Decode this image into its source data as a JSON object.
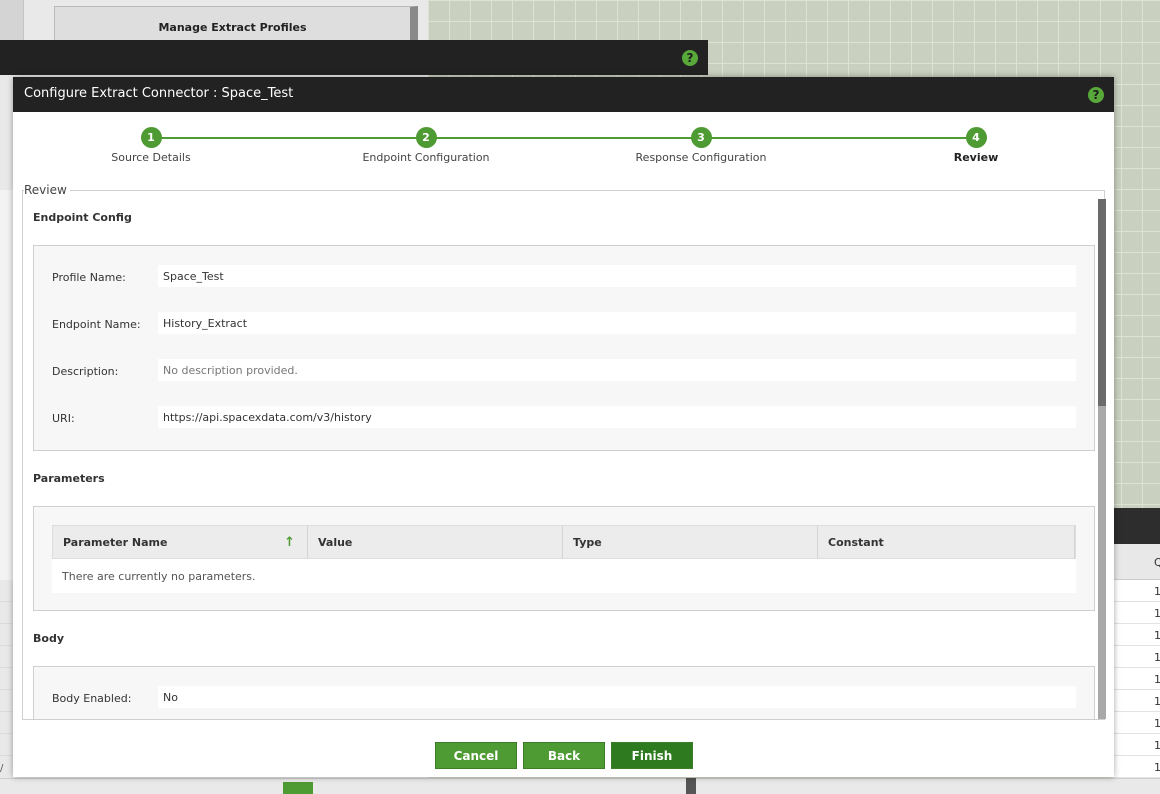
{
  "background": {
    "manage_profiles_title": "Manage Extract Profiles",
    "right_table_header": "Q",
    "right_table_rows": [
      "1",
      "1",
      "1",
      "1",
      "1",
      "1",
      "1",
      "1",
      "1"
    ],
    "left_fragment": "/"
  },
  "dialog": {
    "title": "Configure Extract Connector : Space_Test",
    "help_icon": "?"
  },
  "wizard": {
    "steps": [
      {
        "number": "1",
        "label": "Source Details"
      },
      {
        "number": "2",
        "label": "Endpoint Configuration"
      },
      {
        "number": "3",
        "label": "Response Configuration"
      },
      {
        "number": "4",
        "label": "Review"
      }
    ],
    "active_step": 4
  },
  "review": {
    "legend": "Review",
    "endpoint_config": {
      "title": "Endpoint Config",
      "fields": [
        {
          "label": "Profile Name:",
          "value": "Space_Test"
        },
        {
          "label": "Endpoint Name:",
          "value": "History_Extract"
        },
        {
          "label": "Description:",
          "value": "No description provided."
        },
        {
          "label": "URI:",
          "value": "https://api.spacexdata.com/v3/history"
        }
      ]
    },
    "parameters": {
      "title": "Parameters",
      "columns": [
        "Parameter Name",
        "Value",
        "Type",
        "Constant"
      ],
      "sort_icon": "up-arrow-icon",
      "empty_message": "There are currently no parameters."
    },
    "body": {
      "title": "Body",
      "fields": [
        {
          "label": "Body Enabled:",
          "value": "No"
        }
      ]
    }
  },
  "buttons": {
    "cancel": "Cancel",
    "back": "Back",
    "finish": "Finish"
  },
  "colors": {
    "accent": "#4e9a33",
    "header": "#222222"
  }
}
